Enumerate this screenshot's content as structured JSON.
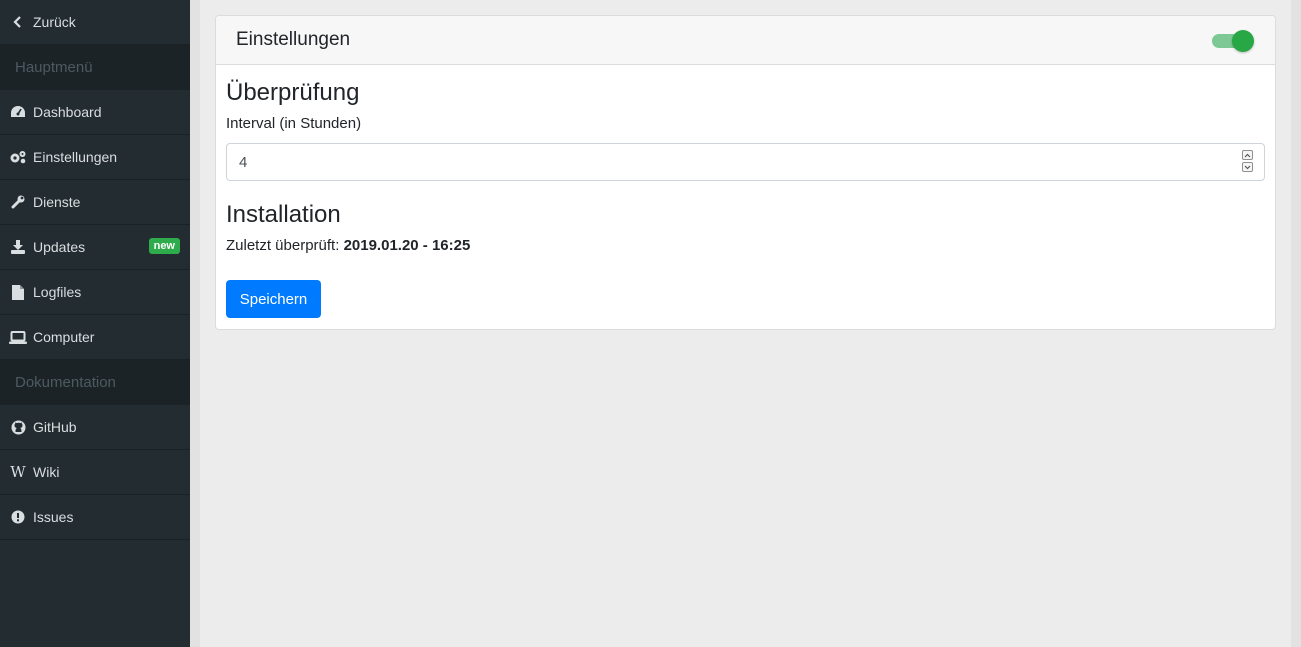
{
  "sidebar": {
    "back_label": "Zurück",
    "sections": [
      {
        "title": "Hauptmenü",
        "items": [
          {
            "label": "Dashboard",
            "icon": "dashboard-icon"
          },
          {
            "label": "Einstellungen",
            "icon": "gears-icon"
          },
          {
            "label": "Dienste",
            "icon": "wrench-icon"
          },
          {
            "label": "Updates",
            "icon": "download-icon",
            "badge": "new"
          },
          {
            "label": "Logfiles",
            "icon": "file-icon"
          },
          {
            "label": "Computer",
            "icon": "laptop-icon"
          }
        ]
      },
      {
        "title": "Dokumentation",
        "items": [
          {
            "label": "GitHub",
            "icon": "github-icon"
          },
          {
            "label": "Wiki",
            "icon": "wikipedia-icon"
          },
          {
            "label": "Issues",
            "icon": "exclamation-circle-icon"
          }
        ]
      }
    ]
  },
  "card": {
    "title": "Einstellungen",
    "toggle_on": true,
    "check_section": {
      "heading": "Überprüfung",
      "interval_label": "Interval (in Stunden)",
      "interval_value": "4"
    },
    "install_section": {
      "heading": "Installation",
      "last_checked_label": "Zuletzt überprüft:",
      "last_checked_value": "2019.01.20 - 16:25"
    },
    "save_label": "Speichern"
  },
  "colors": {
    "sidebar_bg": "#232c30",
    "accent_primary": "#007bff",
    "toggle_green": "#28a745",
    "badge_green": "#2eab4a"
  }
}
